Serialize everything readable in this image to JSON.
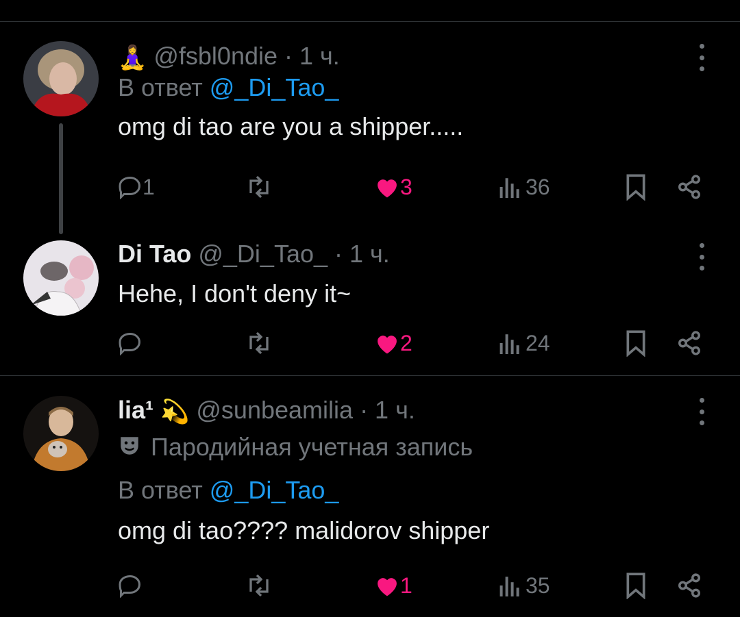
{
  "tweets": [
    {
      "emoji": "🧘‍♀️",
      "handle": "@fsbl0ndie",
      "time": "· 1 ч.",
      "reply_prefix": "В ответ",
      "reply_to": "@_Di_Tao_",
      "text": "omg di tao are you a shipper.....",
      "replies": "1",
      "likes": "3",
      "views": "36"
    },
    {
      "name": "Di Tao",
      "handle": "@_Di_Tao_",
      "time": "· 1 ч.",
      "text": "Hehe, I don't deny it~",
      "likes": "2",
      "views": "24"
    },
    {
      "name": "lia¹",
      "emoji": "💫",
      "handle": "@sunbeamilia",
      "time": "· 1 ч.",
      "label": "Пародийная учетная запись",
      "reply_prefix": "В ответ",
      "reply_to": "@_Di_Tao_",
      "text": "omg di tao???? malidorov shipper",
      "likes": "1",
      "views": "35"
    }
  ],
  "colors": {
    "like": "#f91880",
    "link": "#1d9bf0",
    "muted": "#71767b",
    "background": "#000000"
  }
}
